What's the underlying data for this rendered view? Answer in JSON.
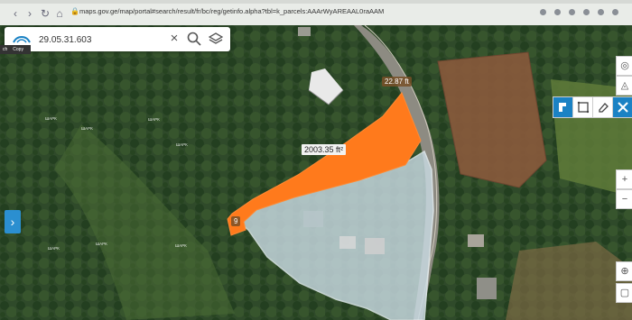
{
  "browser": {
    "url": "maps.gov.ge/map/portal#search/result/fr/bc/reg/getinfo.alpha?tbl=k_parcels:AAArWyAREAAL0raAAM"
  },
  "search": {
    "value": "29.05.31.603"
  },
  "context_menu": {
    "items": [
      "ch",
      "Copy"
    ]
  },
  "map": {
    "measure_top": "22.87 ft",
    "area_label": "2003.35 ft²",
    "measure_left": "9",
    "hill_labels": [
      "ШАРК",
      "ШАРК",
      "ШАРК",
      "ШАРК",
      "ШАРК",
      "ШАРК",
      "ШАРК"
    ]
  },
  "colors": {
    "highlight": "#ff7a1c",
    "parcel_fill": "#c9dbe3",
    "accent": "#1b82c4"
  },
  "icons": [
    "back-icon",
    "forward-icon",
    "reload-icon",
    "home-icon",
    "lock-icon",
    "clear-icon",
    "search-icon",
    "layers-icon",
    "chevron-right-icon",
    "draw-icon",
    "rect-icon",
    "eraser-icon",
    "crossed-tools-icon"
  ]
}
